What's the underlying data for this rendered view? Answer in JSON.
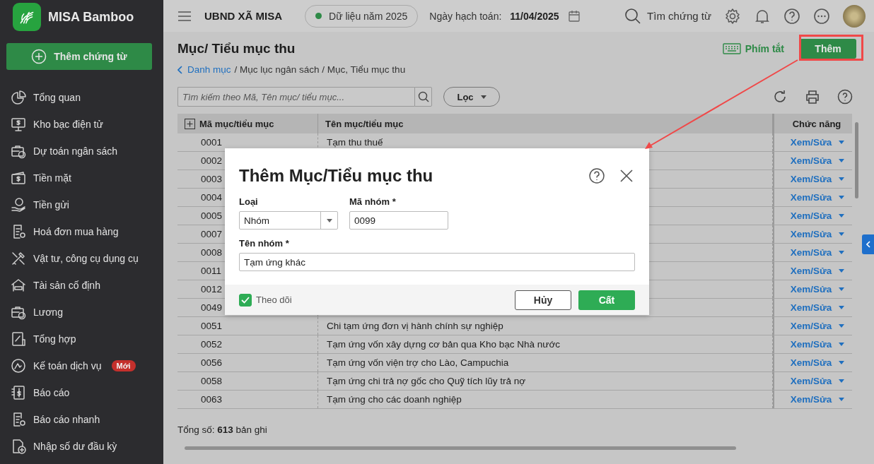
{
  "app": {
    "name": "MISA Bamboo"
  },
  "sidebar": {
    "add_button": "Thêm chứng từ",
    "items": [
      {
        "label": "Tổng quan"
      },
      {
        "label": "Kho bạc điện tử"
      },
      {
        "label": "Dự toán ngân sách"
      },
      {
        "label": "Tiền mặt"
      },
      {
        "label": "Tiền gửi"
      },
      {
        "label": "Hoá đơn mua hàng"
      },
      {
        "label": "Vật tư, công cụ dụng cụ"
      },
      {
        "label": "Tài sản cố định"
      },
      {
        "label": "Lương"
      },
      {
        "label": "Tổng hợp"
      },
      {
        "label": "Kế toán dịch vụ",
        "badge": "Mới"
      },
      {
        "label": "Báo cáo"
      },
      {
        "label": "Báo cáo nhanh"
      },
      {
        "label": "Nhập số dư đầu kỳ"
      }
    ]
  },
  "topbar": {
    "org": "UBND XÃ MISA",
    "data_year": "Dữ liệu năm 2025",
    "date_label": "Ngày hạch toán:",
    "date": "11/04/2025",
    "search": "Tìm chứng từ"
  },
  "page": {
    "title": "Mục/ Tiểu mục thu",
    "breadcrumb_back": "Danh mục",
    "breadcrumb_path": "/ Mục lục ngân sách / Mục, Tiểu mục thu",
    "shortcut": "Phím tắt",
    "add_button": "Thêm"
  },
  "toolbar": {
    "search_placeholder": "Tìm kiếm theo Mã, Tên mục/ tiểu mục...",
    "filter": "Lọc"
  },
  "table": {
    "columns": [
      "Mã mục/tiểu mục",
      "Tên mục/tiểu mục",
      "Chức năng"
    ],
    "rows": [
      {
        "code": "0001",
        "name": "Tạm thu thuế",
        "action": "Xem/Sửa"
      },
      {
        "code": "0002",
        "action": "Xem/Sửa"
      },
      {
        "code": "0003",
        "action": "Xem/Sửa"
      },
      {
        "code": "0004",
        "action": "Xem/Sửa"
      },
      {
        "code": "0005",
        "action": "Xem/Sửa"
      },
      {
        "code": "0007",
        "action": "Xem/Sửa"
      },
      {
        "code": "0008",
        "action": "Xem/Sửa"
      },
      {
        "code": "0011",
        "action": "Xem/Sửa"
      },
      {
        "code": "0012",
        "action": "Xem/Sửa"
      },
      {
        "code": "0049",
        "action": "Xem/Sửa"
      },
      {
        "code": "0051",
        "name": "Chi tạm ứng đơn vị hành chính sự nghiệp",
        "action": "Xem/Sửa"
      },
      {
        "code": "0052",
        "name": "Tạm ứng vốn xây dựng cơ bản qua Kho bạc Nhà nước",
        "action": "Xem/Sửa"
      },
      {
        "code": "0056",
        "name": "Tạm ứng vốn viện trợ cho Lào, Campuchia",
        "action": "Xem/Sửa"
      },
      {
        "code": "0058",
        "name": "Tạm ứng chi trả nợ gốc cho Quỹ tích lũy trả nợ",
        "action": "Xem/Sửa"
      },
      {
        "code": "0063",
        "name": "Tạm ứng cho các doanh nghiệp",
        "action": "Xem/Sửa"
      }
    ],
    "total": "Tổng số:  **613** bản ghi"
  },
  "dialog": {
    "title": "Thêm Mục/Tiểu mục thu",
    "type": {
      "label": "Loại",
      "value": "Nhóm"
    },
    "code": {
      "label": "Mã nhóm *",
      "value": "0099"
    },
    "name": {
      "label": "Tên nhóm *",
      "value": "Tạm ứng khác"
    },
    "track": {
      "label": "Theo dõi",
      "checked": true
    },
    "cancel": "Hủy",
    "save": "Cất"
  }
}
